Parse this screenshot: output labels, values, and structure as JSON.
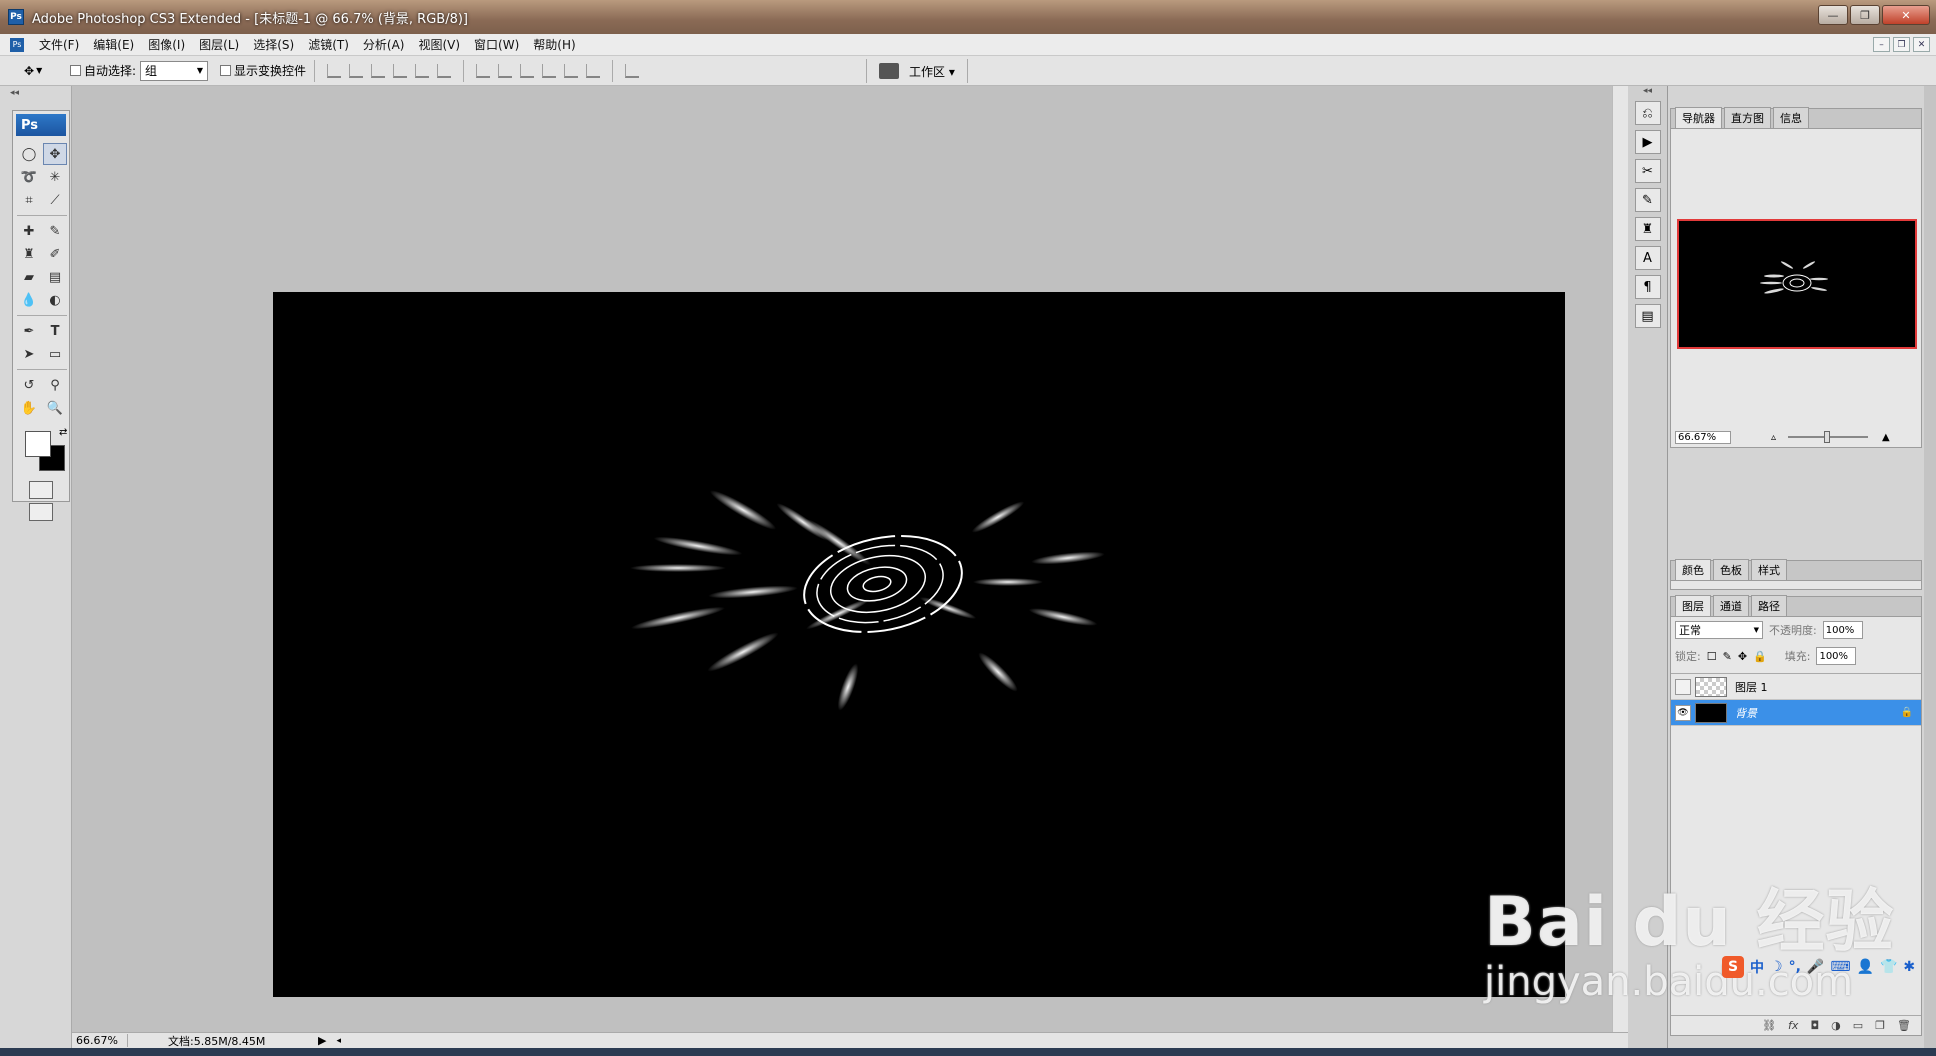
{
  "titlebar": {
    "app_icon": "Ps",
    "title": "Adobe Photoshop CS3 Extended - [未标题-1 @ 66.7% (背景, RGB/8)]",
    "minimize": "—",
    "maximize": "❐",
    "close": "✕"
  },
  "menubar": {
    "items": [
      "文件(F)",
      "编辑(E)",
      "图像(I)",
      "图层(L)",
      "选择(S)",
      "滤镜(T)",
      "分析(A)",
      "视图(V)",
      "窗口(W)",
      "帮助(H)"
    ],
    "doc_controls": [
      "–",
      "❐",
      "✕"
    ]
  },
  "options": {
    "auto_select_label": "自动选择:",
    "auto_select_value": "组",
    "show_transform_label": "显示变换控件",
    "workspace_label": "工作区 ▾"
  },
  "statusbar": {
    "zoom": "66.67%",
    "doc_info": "文档:5.85M/8.45M"
  },
  "navigator_panel": {
    "tabs": [
      "导航器",
      "直方图",
      "信息"
    ],
    "zoom": "66.67%"
  },
  "color_panel": {
    "tabs": [
      "颜色",
      "色板",
      "样式"
    ]
  },
  "layers_panel": {
    "tabs": [
      "图层",
      "通道",
      "路径"
    ],
    "blend_mode": "正常",
    "opacity_label": "不透明度:",
    "opacity_value": "100%",
    "lock_label": "锁定:",
    "fill_label": "填充:",
    "fill_value": "100%",
    "layers": [
      {
        "name": "图层 1",
        "visible": false,
        "selected": false
      },
      {
        "name": "背景",
        "visible": true,
        "selected": true
      }
    ]
  },
  "watermark": {
    "main": "Bai du 经验",
    "sub": "jingyan.baidu.com"
  },
  "ime": {
    "logo": "S",
    "lang": "中"
  },
  "colors": {
    "canvas": "#000000",
    "workspace": "#c0c0c0",
    "selected_layer": "#3b90e8",
    "navigator_frame": "#e23a3a"
  }
}
